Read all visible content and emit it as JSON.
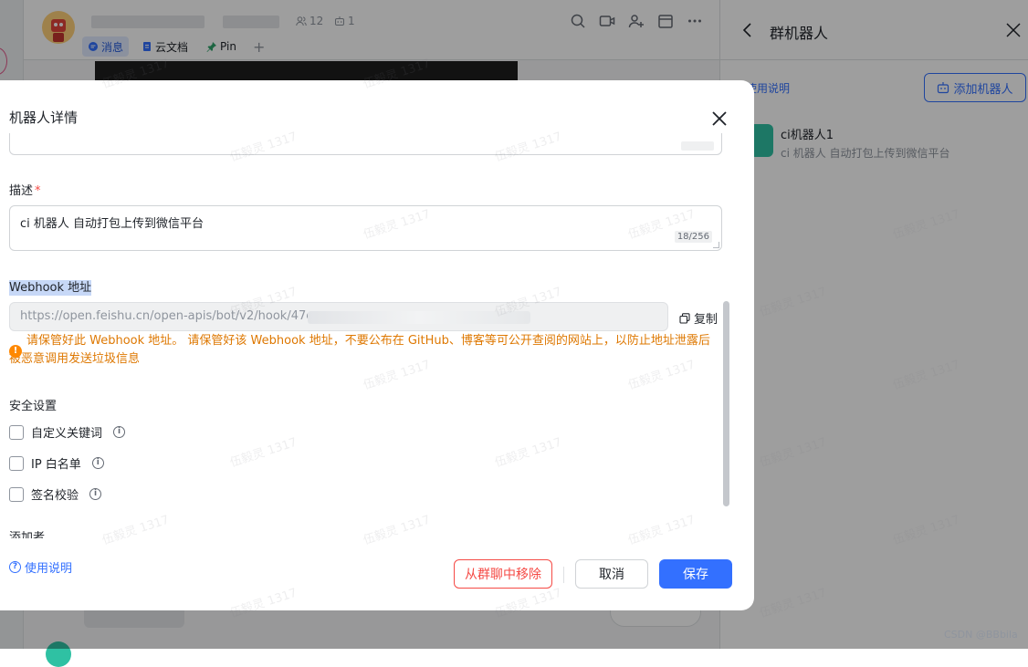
{
  "chat": {
    "member_count": "12",
    "bot_count": "1",
    "tabs": [
      {
        "label": "消息",
        "active": true
      },
      {
        "label": "云文档",
        "active": false
      },
      {
        "label": "Pin",
        "active": false
      }
    ],
    "add_tab": "+"
  },
  "side_panel": {
    "title": "群机器人",
    "usage_link": "使用说明",
    "add_button": "添加机器人",
    "bot": {
      "name": "ci机器人1",
      "description": "ci 机器人 自动打包上传到微信平台"
    }
  },
  "modal": {
    "title": "机器人详情",
    "description_label": "描述",
    "required_mark": "*",
    "description_value": "ci 机器人 自动打包上传到微信平台",
    "description_count": "18/256",
    "webhook_label": "Webhook 地址",
    "webhook_url": "https://open.feishu.cn/open-apis/bot/v2/hook/47e",
    "copy_label": "复制",
    "warning": "请保管好此 Webhook 地址。 请保管好该 Webhook 地址，不要公布在 GitHub、博客等可公开查阅的网站上，以防止地址泄露后被恶意调用发送垃圾信息",
    "warning_icon": "!",
    "security_label": "安全设置",
    "security_options": [
      {
        "label": "自定义关键词",
        "checked": false
      },
      {
        "label": "IP 白名单",
        "checked": false
      },
      {
        "label": "签名校验",
        "checked": false
      }
    ],
    "info_icon": "i",
    "added_by_label": "添加者",
    "footer": {
      "usage_link": "使用说明",
      "help_icon": "?",
      "remove_button": "从群聊中移除",
      "cancel_button": "取消",
      "save_button": "保存"
    }
  },
  "colors": {
    "primary": "#3370ff",
    "danger": "#f54a45",
    "warning": "#de7802",
    "bot_icon": "#2fc1a3"
  },
  "watermark_text": "伍毅灵 1317",
  "csdn_credit": "CSDN @BBbila"
}
